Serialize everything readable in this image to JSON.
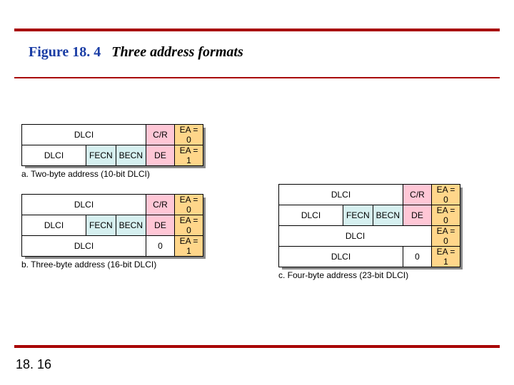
{
  "figure": {
    "number": "Figure 18. 4",
    "caption": "Three address formats"
  },
  "pageNumber": "18. 16",
  "labels": {
    "dlci": "DLCI",
    "fecn": "FECN",
    "becn": "BECN",
    "cr": "C/R",
    "de": "DE",
    "ea0": "EA = 0",
    "ea1": "EA = 1",
    "zero": "0"
  },
  "captions": {
    "a": "a. Two-byte address (10-bit DLCI)",
    "b": "b. Three-byte address (16-bit DLCI)",
    "c": "c. Four-byte address (23-bit DLCI)"
  },
  "chart_data": [
    {
      "type": "table",
      "title": "Two-byte address (10-bit DLCI)",
      "rows": [
        [
          "DLCI",
          "C/R",
          "EA = 0"
        ],
        [
          "DLCI",
          "FECN",
          "BECN",
          "DE",
          "EA = 1"
        ]
      ]
    },
    {
      "type": "table",
      "title": "Three-byte address (16-bit DLCI)",
      "rows": [
        [
          "DLCI",
          "C/R",
          "EA = 0"
        ],
        [
          "DLCI",
          "FECN",
          "BECN",
          "DE",
          "EA = 0"
        ],
        [
          "DLCI",
          "0",
          "EA = 1"
        ]
      ]
    },
    {
      "type": "table",
      "title": "Four-byte address (23-bit DLCI)",
      "rows": [
        [
          "DLCI",
          "C/R",
          "EA = 0"
        ],
        [
          "DLCI",
          "FECN",
          "BECN",
          "DE",
          "EA = 0"
        ],
        [
          "DLCI",
          "EA = 0"
        ],
        [
          "DLCI",
          "0",
          "EA = 1"
        ]
      ]
    }
  ]
}
